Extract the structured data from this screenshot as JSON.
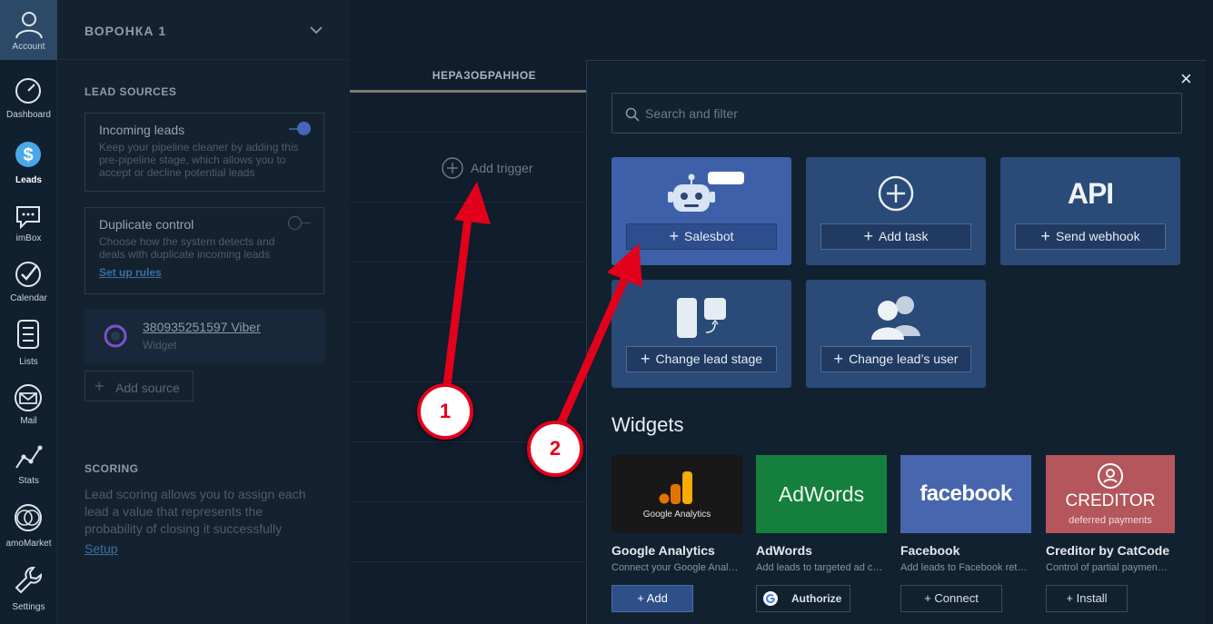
{
  "nav": {
    "account_label": "Account",
    "items": [
      {
        "label": "Dashboard",
        "icon": "speedometer-icon"
      },
      {
        "label": "Leads",
        "icon": "dollar-icon"
      },
      {
        "label": "imBox",
        "icon": "chat-icon"
      },
      {
        "label": "Calendar",
        "icon": "checkmark-icon"
      },
      {
        "label": "Lists",
        "icon": "list-icon"
      },
      {
        "label": "Mail",
        "icon": "envelope-icon"
      },
      {
        "label": "Stats",
        "icon": "stats-icon"
      },
      {
        "label": "amoMarket",
        "icon": "market-icon"
      },
      {
        "label": "Settings",
        "icon": "wrench-icon"
      }
    ]
  },
  "pipeline": {
    "title": "ВОРОНКА 1",
    "lead_sources_head": "LEAD SOURCES",
    "incoming": {
      "title": "Incoming leads",
      "text": "Keep your pipeline cleaner by adding this pre-pipeline stage, which allows you to accept or decline potential leads"
    },
    "duplicate": {
      "title": "Duplicate control",
      "text": "Choose how the system detects and deals with duplicate incoming leads",
      "link": "Set up rules"
    },
    "source": {
      "name": "380935251597 Viber",
      "type": "Widget"
    },
    "add_source": "Add source",
    "scoring_head": "SCORING",
    "scoring_text": "Lead scoring allows you to assign each lead a value that represents the probability of closing it successfully",
    "scoring_link": "Setup"
  },
  "board": {
    "stage_title": "НЕРАЗОБРАННОЕ",
    "add_trigger": "Add trigger"
  },
  "modal": {
    "close": "×",
    "search_placeholder": "Search and filter",
    "tiles": [
      {
        "label": "Salesbot",
        "icon": "robot-icon"
      },
      {
        "label": "Add task",
        "icon": "plus-circle-icon"
      },
      {
        "label": "Send webhook",
        "icon": "api-icon",
        "icon_text": "API"
      },
      {
        "label": "Change lead stage",
        "icon": "stage-icon"
      },
      {
        "label": "Change lead’s user",
        "icon": "users-icon"
      }
    ],
    "widgets_head": "Widgets",
    "widgets": [
      {
        "name": "Google Analytics",
        "desc": "Connect your Google Anal…",
        "button": "+ Add",
        "logo_text": "Google Analytics"
      },
      {
        "name": "AdWords",
        "desc": "Add leads to targeted ad c…",
        "button": "Authorize",
        "logo_text": "AdWords"
      },
      {
        "name": "Facebook",
        "desc": "Add leads to Facebook ret…",
        "button": "+ Connect",
        "logo_text": "facebook"
      },
      {
        "name": "Creditor by CatCode",
        "desc": "Control of partial paymen…",
        "button": "+ Install",
        "logo_text": "CREDITOR",
        "logo_sub": "deferred payments"
      }
    ]
  },
  "callouts": [
    "1",
    "2"
  ],
  "colors": {
    "accent": "#3e60a8",
    "arrow": "#e3001b"
  }
}
